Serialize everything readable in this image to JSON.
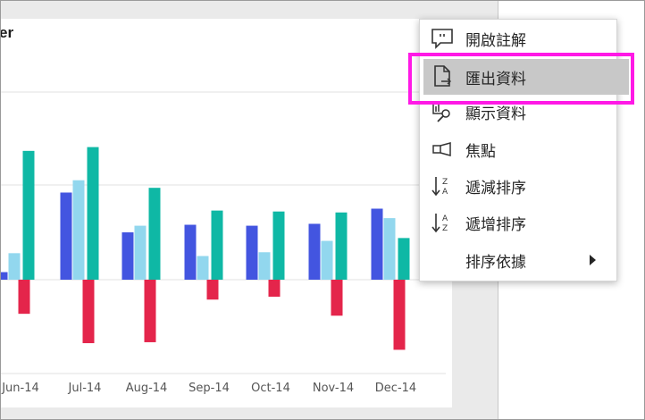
{
  "visual": {
    "title": "er"
  },
  "menu": {
    "items": [
      {
        "label": "開啟註解",
        "icon": "comment-icon"
      },
      {
        "label": "匯出資料",
        "icon": "export-data-icon",
        "highlighted": true
      },
      {
        "label": "顯示資料",
        "icon": "show-data-icon"
      },
      {
        "label": "焦點",
        "icon": "spotlight-icon"
      },
      {
        "label": "遞減排序",
        "icon": "sort-descending-icon"
      },
      {
        "label": "遞增排序",
        "icon": "sort-ascending-icon"
      },
      {
        "label": "排序依據",
        "icon": "chevron-right-icon",
        "has_submenu": true
      }
    ]
  },
  "colors": {
    "highlight_border": "#ff19e6",
    "menu_hover": "#c8c8c8"
  },
  "chart_data": {
    "type": "bar",
    "categories": [
      "Jun-14",
      "Jul-14",
      "Aug-14",
      "Sep-14",
      "Oct-14",
      "Nov-14",
      "Dec-14"
    ],
    "series": [
      {
        "values": [
          0.08,
          0.92,
          0.5,
          0.58,
          0.57,
          0.59,
          0.75
        ],
        "color": "#4355e0"
      },
      {
        "values": [
          0.28,
          1.05,
          0.57,
          0.25,
          0.29,
          0.41,
          0.65
        ],
        "color": "#92d7ee"
      },
      {
        "values": [
          1.36,
          1.4,
          0.97,
          0.73,
          0.72,
          0.71,
          0.44
        ],
        "color": "#0fb8a5"
      },
      {
        "values": [
          -0.36,
          -0.67,
          -0.66,
          -0.21,
          -0.18,
          -0.38,
          -0.74
        ],
        "color": "#e4254b"
      }
    ],
    "ylim": [
      -1.0,
      2.0
    ],
    "grid": true,
    "legend": "none"
  }
}
